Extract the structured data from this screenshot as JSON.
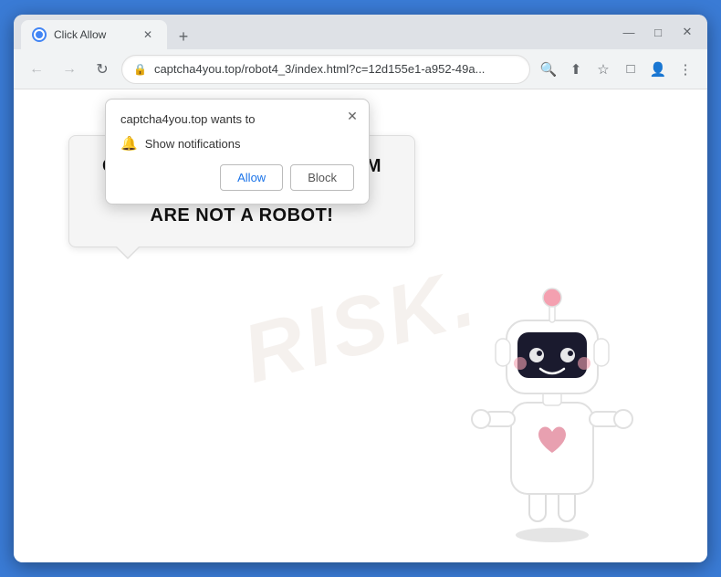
{
  "browser": {
    "tab": {
      "title": "Click Allow",
      "favicon_label": "globe-favicon"
    },
    "new_tab_label": "+",
    "window_controls": {
      "minimize": "—",
      "maximize": "□",
      "close": "✕"
    },
    "nav": {
      "back": "←",
      "forward": "→",
      "refresh": "↻"
    },
    "address": {
      "lock_icon": "🔒",
      "url": "captcha4you.top/robot4_3/index.html?c=12d155e1-a952-49a..."
    },
    "toolbar_icons": {
      "search": "🔍",
      "share": "↗",
      "bookmark": "☆",
      "extension": "□",
      "profile": "👤",
      "menu": "⋮"
    }
  },
  "notification_popup": {
    "title": "captcha4you.top wants to",
    "close_label": "✕",
    "notification_row": {
      "icon": "🔔",
      "text": "Show notifications"
    },
    "buttons": {
      "allow": "Allow",
      "block": "Block"
    }
  },
  "page": {
    "main_text_line1": "CLICK «ALLOW» TO CONFIRM THAT YOU",
    "main_text_line2": "ARE NOT A ROBOT!",
    "watermark": "RISK."
  }
}
